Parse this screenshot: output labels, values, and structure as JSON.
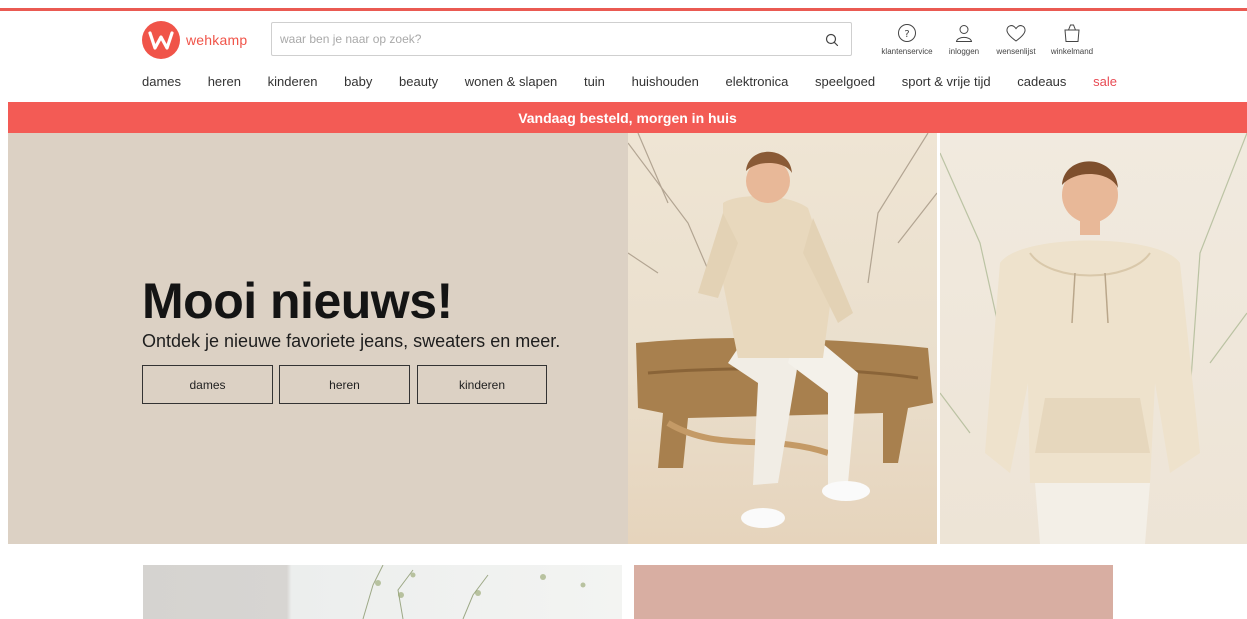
{
  "header": {
    "logo_text": "wehkamp",
    "search": {
      "placeholder": "waar ben je naar op zoek?",
      "value": ""
    },
    "icons": [
      {
        "label": "klantenservice",
        "icon": "help-circle-icon"
      },
      {
        "label": "inloggen",
        "icon": "user-icon"
      },
      {
        "label": "wensenlijst",
        "icon": "heart-icon"
      },
      {
        "label": "winkelmand",
        "icon": "shopping-bag-icon"
      }
    ]
  },
  "nav": {
    "items": [
      "dames",
      "heren",
      "kinderen",
      "baby",
      "beauty",
      "wonen & slapen",
      "tuin",
      "huishouden",
      "elektronica",
      "speelgoed",
      "sport & vrije tijd",
      "cadeaus",
      "sale"
    ]
  },
  "banner": {
    "text": "Vandaag besteld, morgen in huis"
  },
  "hero": {
    "title": "Mooi nieuws!",
    "subtitle": "Ontdek je nieuwe favoriete jeans, sweaters en meer.",
    "buttons": [
      "dames",
      "heren",
      "kinderen"
    ]
  },
  "colors": {
    "brand": "#f05449",
    "banner": "#f35b55",
    "sale": "#e84b54",
    "hero_bg": "#dcd1c4"
  }
}
